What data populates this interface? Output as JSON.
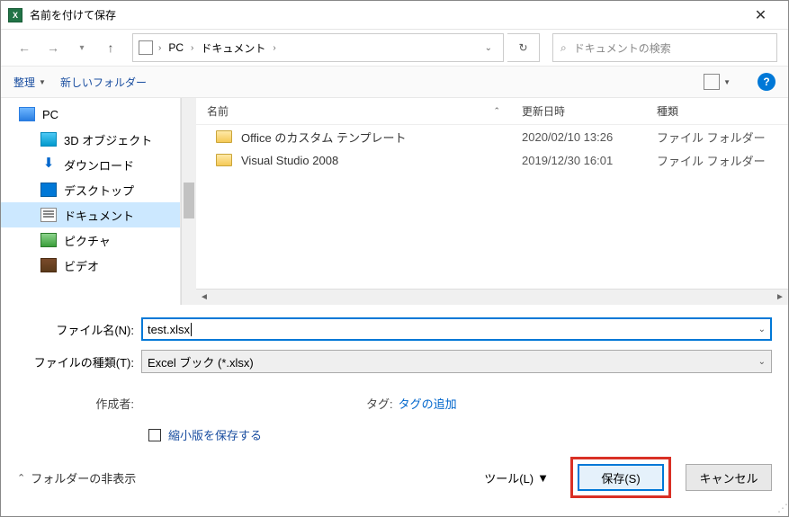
{
  "window": {
    "title": "名前を付けて保存"
  },
  "breadcrumb": {
    "root": "PC",
    "folder": "ドキュメント"
  },
  "search": {
    "placeholder": "ドキュメントの検索"
  },
  "toolbar": {
    "organize": "整理",
    "newfolder": "新しいフォルダー"
  },
  "tree": {
    "pc": "PC",
    "items": [
      "3D オブジェクト",
      "ダウンロード",
      "デスクトップ",
      "ドキュメント",
      "ピクチャ",
      "ビデオ"
    ]
  },
  "columns": {
    "name": "名前",
    "date": "更新日時",
    "type": "種類"
  },
  "files": [
    {
      "name": "Office のカスタム テンプレート",
      "date": "2020/02/10 13:26",
      "type": "ファイル フォルダー"
    },
    {
      "name": "Visual Studio 2008",
      "date": "2019/12/30 16:01",
      "type": "ファイル フォルダー"
    }
  ],
  "form": {
    "filename_label": "ファイル名(N):",
    "filename_value": "test.xlsx",
    "filetype_label": "ファイルの種類(T):",
    "filetype_value": "Excel ブック (*.xlsx)"
  },
  "meta": {
    "author_label": "作成者:",
    "tags_label": "タグ:",
    "tags_value": "タグの追加"
  },
  "thumbnail": {
    "label": "縮小版を保存する"
  },
  "footer": {
    "hide": "フォルダーの非表示",
    "tools": "ツール(L)",
    "save": "保存(S)",
    "cancel": "キャンセル"
  }
}
